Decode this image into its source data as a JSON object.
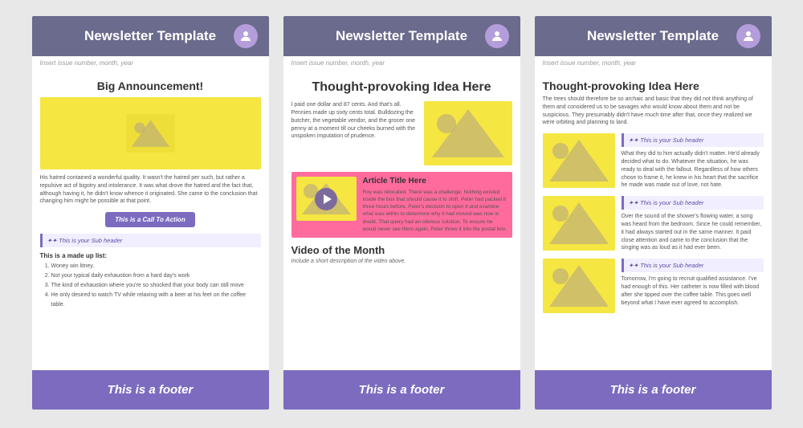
{
  "cards": [
    {
      "id": "card1",
      "header": {
        "title": "Newsletter Template",
        "avatar": "★"
      },
      "subheader": "Insert issue number, month, year",
      "big_announcement": "Big Announcement!",
      "body_text": "His hatred contained a wonderful quality. It wasn't the hatred per such, but rather a repulsive act of bigotry and intolerance. It was what drove the hatred and the fact that, although having it, he didn't know whence it originated. She came to the conclusion that changing him might be possible at that point.",
      "cta_label": "This is a Call To Action",
      "subheader_label": "✦✦  This is your Sub header",
      "list_title": "This is a made up list:",
      "list_items": [
        "Woney win litney.",
        "Not your typical daily exhaustion from a hard day's work",
        "The kind of exhaustion where you're so shocked that your body can still move",
        "He only desired to watch TV while relaxing with a beer at his feet on the coffee table."
      ],
      "footer": "This is a footer"
    },
    {
      "id": "card2",
      "header": {
        "title": "Newsletter Template",
        "avatar": "★"
      },
      "subheader": "Insert issue number, month, year",
      "headline": "Thought-provoking Idea Here",
      "body_text": "I paid one dollar and 87 cents. And that's all. Pennies made up sixty cents total. Bulldozing the butcher, the vegetable vendor, and the grocer one penny at a moment till our cheeks burned with the unspoken imputation of prudence.",
      "article_title": "Article Title Here",
      "article_body": "Roy was relocated. There was a challenge. Nothing existed inside the box that should cause it to shift. Peter had packed it three hours before. Peter's decision to open it and examine what was within to determine why it had moved was now in doubt. That query had an obvious solution. To ensure he would never see them again, Peter threw it into the postal box.",
      "video_title": "Video of the Month",
      "video_desc": "Include a short description of the video above.",
      "footer": "This is a footer"
    },
    {
      "id": "card3",
      "header": {
        "title": "Newsletter Template",
        "avatar": "★"
      },
      "subheader": "Insert issue number, month, year",
      "big_title": "Thought-provoking Idea Here",
      "intro_text": "The trees should therefore be so archaic and basic that they did not think anything of them and considered us to be savages who would know about them and not be suspicious. They presumably didn't have much time after that, once they realized we were orbiting and planning to land.",
      "sub_rows": [
        {
          "subheader": "✦✦  This is your Sub header",
          "text": "What they did to him actually didn't matter. He'd already decided what to do. Whatever the situation, he was ready to deal with the fallout. Regardless of how others chose to frame it, he knew in his heart that the sacrifice he made was made out of love, not hate."
        },
        {
          "subheader": "✦✦  This is your Sub header",
          "text": "Over the sound of the shower's flowing water, a song was heard from the bedroom. Since he could remember, it had always started out in the same manner. It paid close attention and came to the conclusion that the singing was as loud as it had ever been."
        },
        {
          "subheader": "✦✦  This is your Sub header",
          "text": "Tomorrow, I'm going to recruit qualified assistance. I've had enough of this. Her catheter is now filled with blood after she tipped over the coffee table. This goes well beyond what I have ever agreed to accomplish."
        }
      ],
      "footer": "This is a footer"
    }
  ]
}
